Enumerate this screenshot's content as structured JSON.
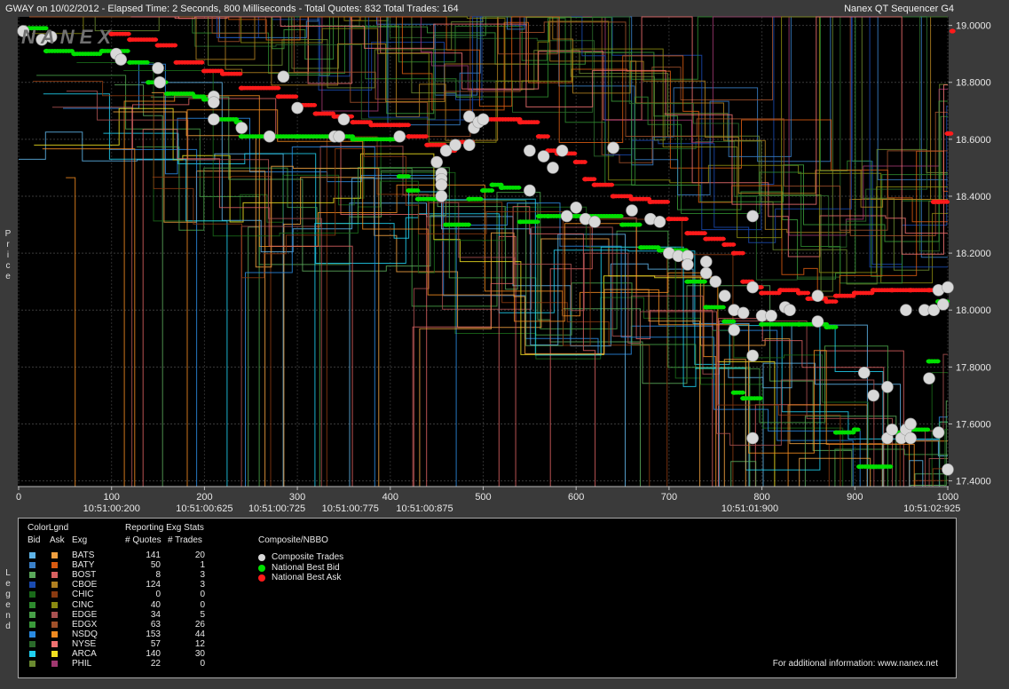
{
  "header": {
    "left": "GWAY on 10/02/2012  -  Elapsed Time: 2 Seconds, 800 Milliseconds  -  Total Quotes: 832  Total Trades: 164",
    "right": "Nanex QT Sequencer G4"
  },
  "watermark": "NANEX",
  "side_labels": {
    "price": "Price",
    "legend": "Legend"
  },
  "colors": {
    "background": "#000000",
    "frame": "#3a3a3a",
    "nbb": "#00e000",
    "nba": "#ff1a1a",
    "trade": "#d8d8d8"
  },
  "chart_data": {
    "type": "scatter",
    "xlim": [
      0,
      1000
    ],
    "ylim": [
      17.38,
      19.03
    ],
    "x_ticks": [
      "0",
      "100",
      "200",
      "300",
      "400",
      "500",
      "600",
      "700",
      "800",
      "900",
      "1000"
    ],
    "y_ticks": [
      "19.0000",
      "18.8000",
      "18.6000",
      "18.4000",
      "18.2000",
      "18.0000",
      "17.8000",
      "17.6000",
      "17.4000"
    ],
    "time_labels": [
      {
        "x": 100,
        "label": "10:51:00:200"
      },
      {
        "x": 200,
        "label": "10:51:00:625"
      },
      {
        "x": 278,
        "label": "10:51:00:725"
      },
      {
        "x": 357,
        "label": "10:51:00:775"
      },
      {
        "x": 437,
        "label": "10:51:00:875"
      },
      {
        "x": 787,
        "label": "10:51:01:900"
      },
      {
        "x": 983,
        "label": "10:51:02:925"
      }
    ],
    "series": [
      {
        "name": "Composite Trades",
        "points": [
          [
            5,
            18.98
          ],
          [
            25,
            18.95
          ],
          [
            35,
            18.96
          ],
          [
            105,
            18.9
          ],
          [
            110,
            18.88
          ],
          [
            150,
            18.85
          ],
          [
            152,
            18.8
          ],
          [
            210,
            18.75
          ],
          [
            210,
            18.73
          ],
          [
            210,
            18.67
          ],
          [
            240,
            18.64
          ],
          [
            270,
            18.61
          ],
          [
            285,
            18.82
          ],
          [
            300,
            18.71
          ],
          [
            340,
            18.61
          ],
          [
            345,
            18.61
          ],
          [
            350,
            18.67
          ],
          [
            410,
            18.61
          ],
          [
            450,
            18.52
          ],
          [
            455,
            18.48
          ],
          [
            455,
            18.46
          ],
          [
            455,
            18.44
          ],
          [
            455,
            18.4
          ],
          [
            460,
            18.56
          ],
          [
            470,
            18.58
          ],
          [
            485,
            18.58
          ],
          [
            485,
            18.68
          ],
          [
            490,
            18.64
          ],
          [
            495,
            18.66
          ],
          [
            500,
            18.67
          ],
          [
            550,
            18.56
          ],
          [
            550,
            18.42
          ],
          [
            565,
            18.54
          ],
          [
            575,
            18.5
          ],
          [
            585,
            18.56
          ],
          [
            590,
            18.33
          ],
          [
            600,
            18.36
          ],
          [
            610,
            18.32
          ],
          [
            620,
            18.31
          ],
          [
            640,
            18.57
          ],
          [
            660,
            18.35
          ],
          [
            680,
            18.32
          ],
          [
            690,
            18.31
          ],
          [
            700,
            18.2
          ],
          [
            710,
            18.19
          ],
          [
            720,
            18.19
          ],
          [
            720,
            18.16
          ],
          [
            740,
            18.13
          ],
          [
            740,
            18.17
          ],
          [
            750,
            18.1
          ],
          [
            760,
            18.05
          ],
          [
            770,
            18
          ],
          [
            780,
            17.99
          ],
          [
            790,
            18.33
          ],
          [
            790,
            18.08
          ],
          [
            770,
            17.93
          ],
          [
            790,
            17.55
          ],
          [
            790,
            17.84
          ],
          [
            800,
            17.98
          ],
          [
            810,
            17.98
          ],
          [
            825,
            18.01
          ],
          [
            830,
            18
          ],
          [
            860,
            18.05
          ],
          [
            860,
            17.96
          ],
          [
            910,
            17.78
          ],
          [
            920,
            17.7
          ],
          [
            935,
            17.73
          ],
          [
            935,
            17.55
          ],
          [
            940,
            17.58
          ],
          [
            950,
            17.55
          ],
          [
            955,
            17.58
          ],
          [
            960,
            17.55
          ],
          [
            960,
            17.6
          ],
          [
            955,
            18
          ],
          [
            975,
            18
          ],
          [
            980,
            17.76
          ],
          [
            990,
            17.57
          ],
          [
            985,
            18
          ],
          [
            990,
            18.07
          ],
          [
            995,
            18.02
          ],
          [
            1000,
            18.08
          ],
          [
            1000,
            17.44
          ]
        ]
      },
      {
        "name": "National Best Bid",
        "points": [
          [
            5,
            18.99
          ],
          [
            30,
            18.91
          ],
          [
            60,
            18.9
          ],
          [
            90,
            18.91
          ],
          [
            120,
            18.87
          ],
          [
            140,
            18.8
          ],
          [
            160,
            18.76
          ],
          [
            190,
            18.75
          ],
          [
            200,
            18.74
          ],
          [
            210,
            18.67
          ],
          [
            235,
            18.66
          ],
          [
            240,
            18.61
          ],
          [
            300,
            18.61
          ],
          [
            350,
            18.61
          ],
          [
            360,
            18.6
          ],
          [
            400,
            18.6
          ],
          [
            410,
            18.47
          ],
          [
            420,
            18.42
          ],
          [
            430,
            18.39
          ],
          [
            460,
            18.3
          ],
          [
            485,
            18.39
          ],
          [
            500,
            18.42
          ],
          [
            510,
            18.44
          ],
          [
            520,
            18.43
          ],
          [
            540,
            18.31
          ],
          [
            560,
            18.33
          ],
          [
            570,
            18.33
          ],
          [
            600,
            18.33
          ],
          [
            650,
            18.3
          ],
          [
            665,
            18.3
          ],
          [
            670,
            18.22
          ],
          [
            690,
            18.21
          ],
          [
            700,
            18.21
          ],
          [
            720,
            18.1
          ],
          [
            740,
            18.01
          ],
          [
            760,
            17.96
          ],
          [
            770,
            17.71
          ],
          [
            780,
            17.69
          ],
          [
            800,
            17.95
          ],
          [
            840,
            17.95
          ],
          [
            860,
            17.95
          ],
          [
            870,
            17.94
          ],
          [
            880,
            17.57
          ],
          [
            900,
            17.58
          ],
          [
            905,
            17.45
          ],
          [
            920,
            17.45
          ],
          [
            940,
            17.57
          ],
          [
            960,
            17.58
          ],
          [
            980,
            17.82
          ],
          [
            990,
            18.03
          ],
          [
            1000,
            18.07
          ]
        ]
      },
      {
        "name": "National Best Ask",
        "points": [
          [
            100,
            18.97
          ],
          [
            120,
            18.95
          ],
          [
            150,
            18.93
          ],
          [
            170,
            18.87
          ],
          [
            200,
            18.84
          ],
          [
            220,
            18.83
          ],
          [
            240,
            18.78
          ],
          [
            280,
            18.75
          ],
          [
            300,
            18.72
          ],
          [
            320,
            18.69
          ],
          [
            340,
            18.68
          ],
          [
            360,
            18.66
          ],
          [
            380,
            18.65
          ],
          [
            410,
            18.65
          ],
          [
            420,
            18.61
          ],
          [
            440,
            18.58
          ],
          [
            460,
            18.56
          ],
          [
            470,
            18.59
          ],
          [
            490,
            18.67
          ],
          [
            500,
            18.67
          ],
          [
            540,
            18.66
          ],
          [
            560,
            18.61
          ],
          [
            570,
            18.56
          ],
          [
            580,
            18.55
          ],
          [
            600,
            18.52
          ],
          [
            610,
            18.46
          ],
          [
            620,
            18.44
          ],
          [
            640,
            18.4
          ],
          [
            660,
            18.39
          ],
          [
            680,
            18.38
          ],
          [
            700,
            18.32
          ],
          [
            720,
            18.27
          ],
          [
            740,
            18.25
          ],
          [
            760,
            18.23
          ],
          [
            770,
            18.2
          ],
          [
            780,
            18.1
          ],
          [
            790,
            18.08
          ],
          [
            800,
            18.06
          ],
          [
            820,
            18.07
          ],
          [
            840,
            18.06
          ],
          [
            850,
            18.04
          ],
          [
            870,
            18.03
          ],
          [
            880,
            18.05
          ],
          [
            900,
            18.06
          ],
          [
            920,
            18.07
          ],
          [
            940,
            18.07
          ],
          [
            960,
            18.07
          ],
          [
            980,
            18.07
          ],
          [
            985,
            18.38
          ],
          [
            990,
            18.38
          ],
          [
            1000,
            18.62
          ],
          [
            1005,
            18.98
          ]
        ]
      }
    ]
  },
  "legend": {
    "title_colorlgnd": "ColorLgnd",
    "col_bid": "Bid",
    "col_ask": "Ask",
    "col_exg": "Exg",
    "title_stats": "Reporting Exg Stats",
    "col_quotes": "# Quotes",
    "col_trades": "# Trades",
    "title_composite": "Composite/NBBO",
    "composite_items": [
      {
        "label": "Composite Trades",
        "color": "#d8d8d8"
      },
      {
        "label": "National Best Bid",
        "color": "#00e000"
      },
      {
        "label": "National Best Ask",
        "color": "#ff1a1a"
      }
    ],
    "rows": [
      {
        "exg": "BATS",
        "quotes": "141",
        "trades": "20",
        "bid": "#5fb4e8",
        "ask": "#f0a040"
      },
      {
        "exg": "BATY",
        "quotes": "50",
        "trades": "1",
        "bid": "#3a80c8",
        "ask": "#d85a10"
      },
      {
        "exg": "BOST",
        "quotes": "8",
        "trades": "3",
        "bid": "#5aa85a",
        "ask": "#d86060"
      },
      {
        "exg": "CBOE",
        "quotes": "124",
        "trades": "3",
        "bid": "#1a4ab0",
        "ask": "#b08020"
      },
      {
        "exg": "CHIC",
        "quotes": "0",
        "trades": "0",
        "bid": "#1a6a1a",
        "ask": "#8a3a10"
      },
      {
        "exg": "CINC",
        "quotes": "40",
        "trades": "0",
        "bid": "#2e8a2e",
        "ask": "#8a8a10"
      },
      {
        "exg": "EDGE",
        "quotes": "34",
        "trades": "5",
        "bid": "#48a048",
        "ask": "#a85050"
      },
      {
        "exg": "EDGX",
        "quotes": "63",
        "trades": "26",
        "bid": "#3a9a3a",
        "ask": "#a0502a"
      },
      {
        "exg": "NSDQ",
        "quotes": "153",
        "trades": "44",
        "bid": "#2a8ae0",
        "ask": "#f08a20"
      },
      {
        "exg": "NYSE",
        "quotes": "57",
        "trades": "12",
        "bid": "#2a6a2a",
        "ask": "#f07070"
      },
      {
        "exg": "ARCA",
        "quotes": "140",
        "trades": "30",
        "bid": "#20d0f0",
        "ask": "#f0e020"
      },
      {
        "exg": "PHIL",
        "quotes": "22",
        "trades": "0",
        "bid": "#6a8a30",
        "ask": "#a03870"
      }
    ],
    "footer": "For additional information: www.nanex.net"
  }
}
